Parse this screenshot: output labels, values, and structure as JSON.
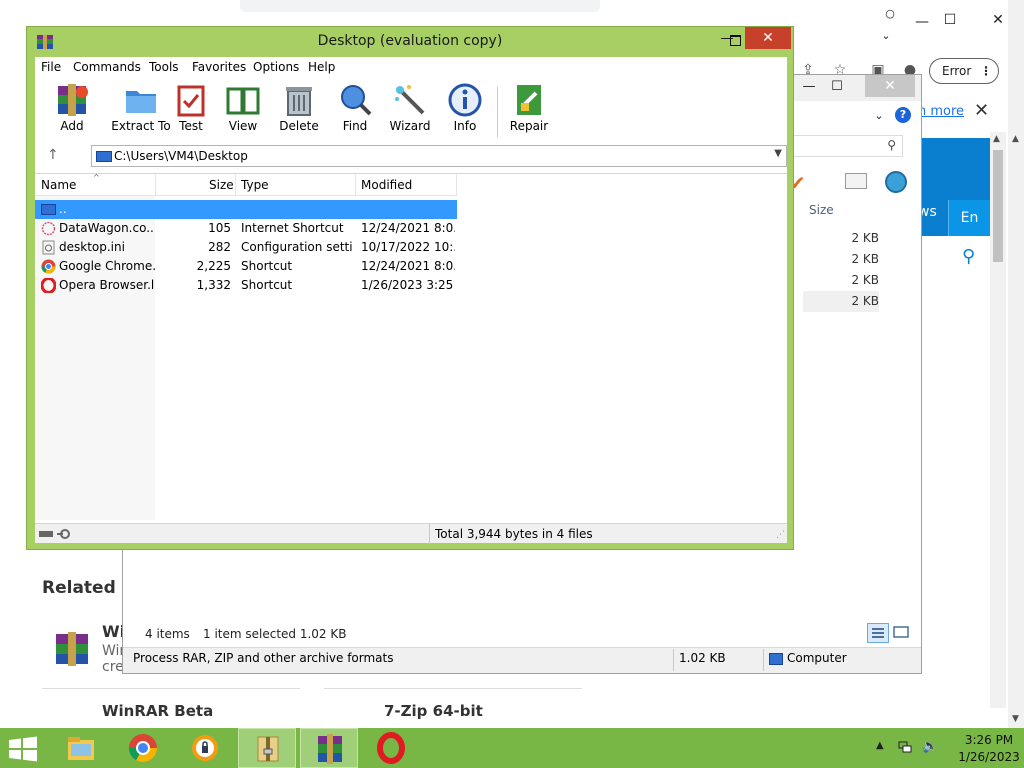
{
  "browser": {
    "error_chip": "Error",
    "learn_more": "n more",
    "nav_ws": "ws",
    "nav_en": "En",
    "related_heading": "Related S",
    "related_item_1_title": "Wi",
    "related_item_1_sub1": "Win",
    "related_item_1_sub2": "cre",
    "related_item_2_title": "WinRAR Beta",
    "related_item_3_title": "7-Zip 64-bit"
  },
  "explorer": {
    "col_size": "Size",
    "sizes": [
      "2 KB",
      "2 KB",
      "2 KB",
      "2 KB"
    ],
    "status_items": "4 items",
    "status_selected": "1 item selected  1.02 KB",
    "bottom_desc": "Process RAR, ZIP and other archive formats",
    "bottom_size": "1.02 KB",
    "bottom_location": "Computer"
  },
  "winrar": {
    "title": "Desktop (evaluation copy)",
    "menu": [
      "File",
      "Commands",
      "Tools",
      "Favorites",
      "Options",
      "Help"
    ],
    "tools": [
      "Add",
      "Extract To",
      "Test",
      "View",
      "Delete",
      "Find",
      "Wizard",
      "Info",
      "Repair"
    ],
    "path": "C:\\Users\\VM4\\Desktop",
    "columns": {
      "name": "Name",
      "size": "Size",
      "type": "Type",
      "modified": "Modified"
    },
    "files": [
      {
        "name": "..",
        "size": "",
        "type": "",
        "modified": ""
      },
      {
        "name": "DataWagon.co...",
        "size": "105",
        "type": "Internet Shortcut",
        "modified": "12/24/2021 8:0..."
      },
      {
        "name": "desktop.ini",
        "size": "282",
        "type": "Configuration setti...",
        "modified": "10/17/2022 10:..."
      },
      {
        "name": "Google Chrome....",
        "size": "2,225",
        "type": "Shortcut",
        "modified": "12/24/2021 8:0..."
      },
      {
        "name": "Opera Browser.lnk",
        "size": "1,332",
        "type": "Shortcut",
        "modified": "1/26/2023 3:25 ..."
      }
    ],
    "status_total": "Total 3,944 bytes in 4 files"
  },
  "taskbar": {
    "apps": [
      "file-explorer-icon",
      "chrome-icon",
      "browser-shield-icon",
      "archive-icon",
      "winrar-icon",
      "opera-icon"
    ],
    "time": "3:26 PM",
    "date": "1/26/2023"
  },
  "colors": {
    "winrar_frame": "#a7cf64",
    "taskbar": "#78b646",
    "selection": "#3399ff",
    "close_button": "#c7412a",
    "site_blue": "#0b7fcf"
  }
}
